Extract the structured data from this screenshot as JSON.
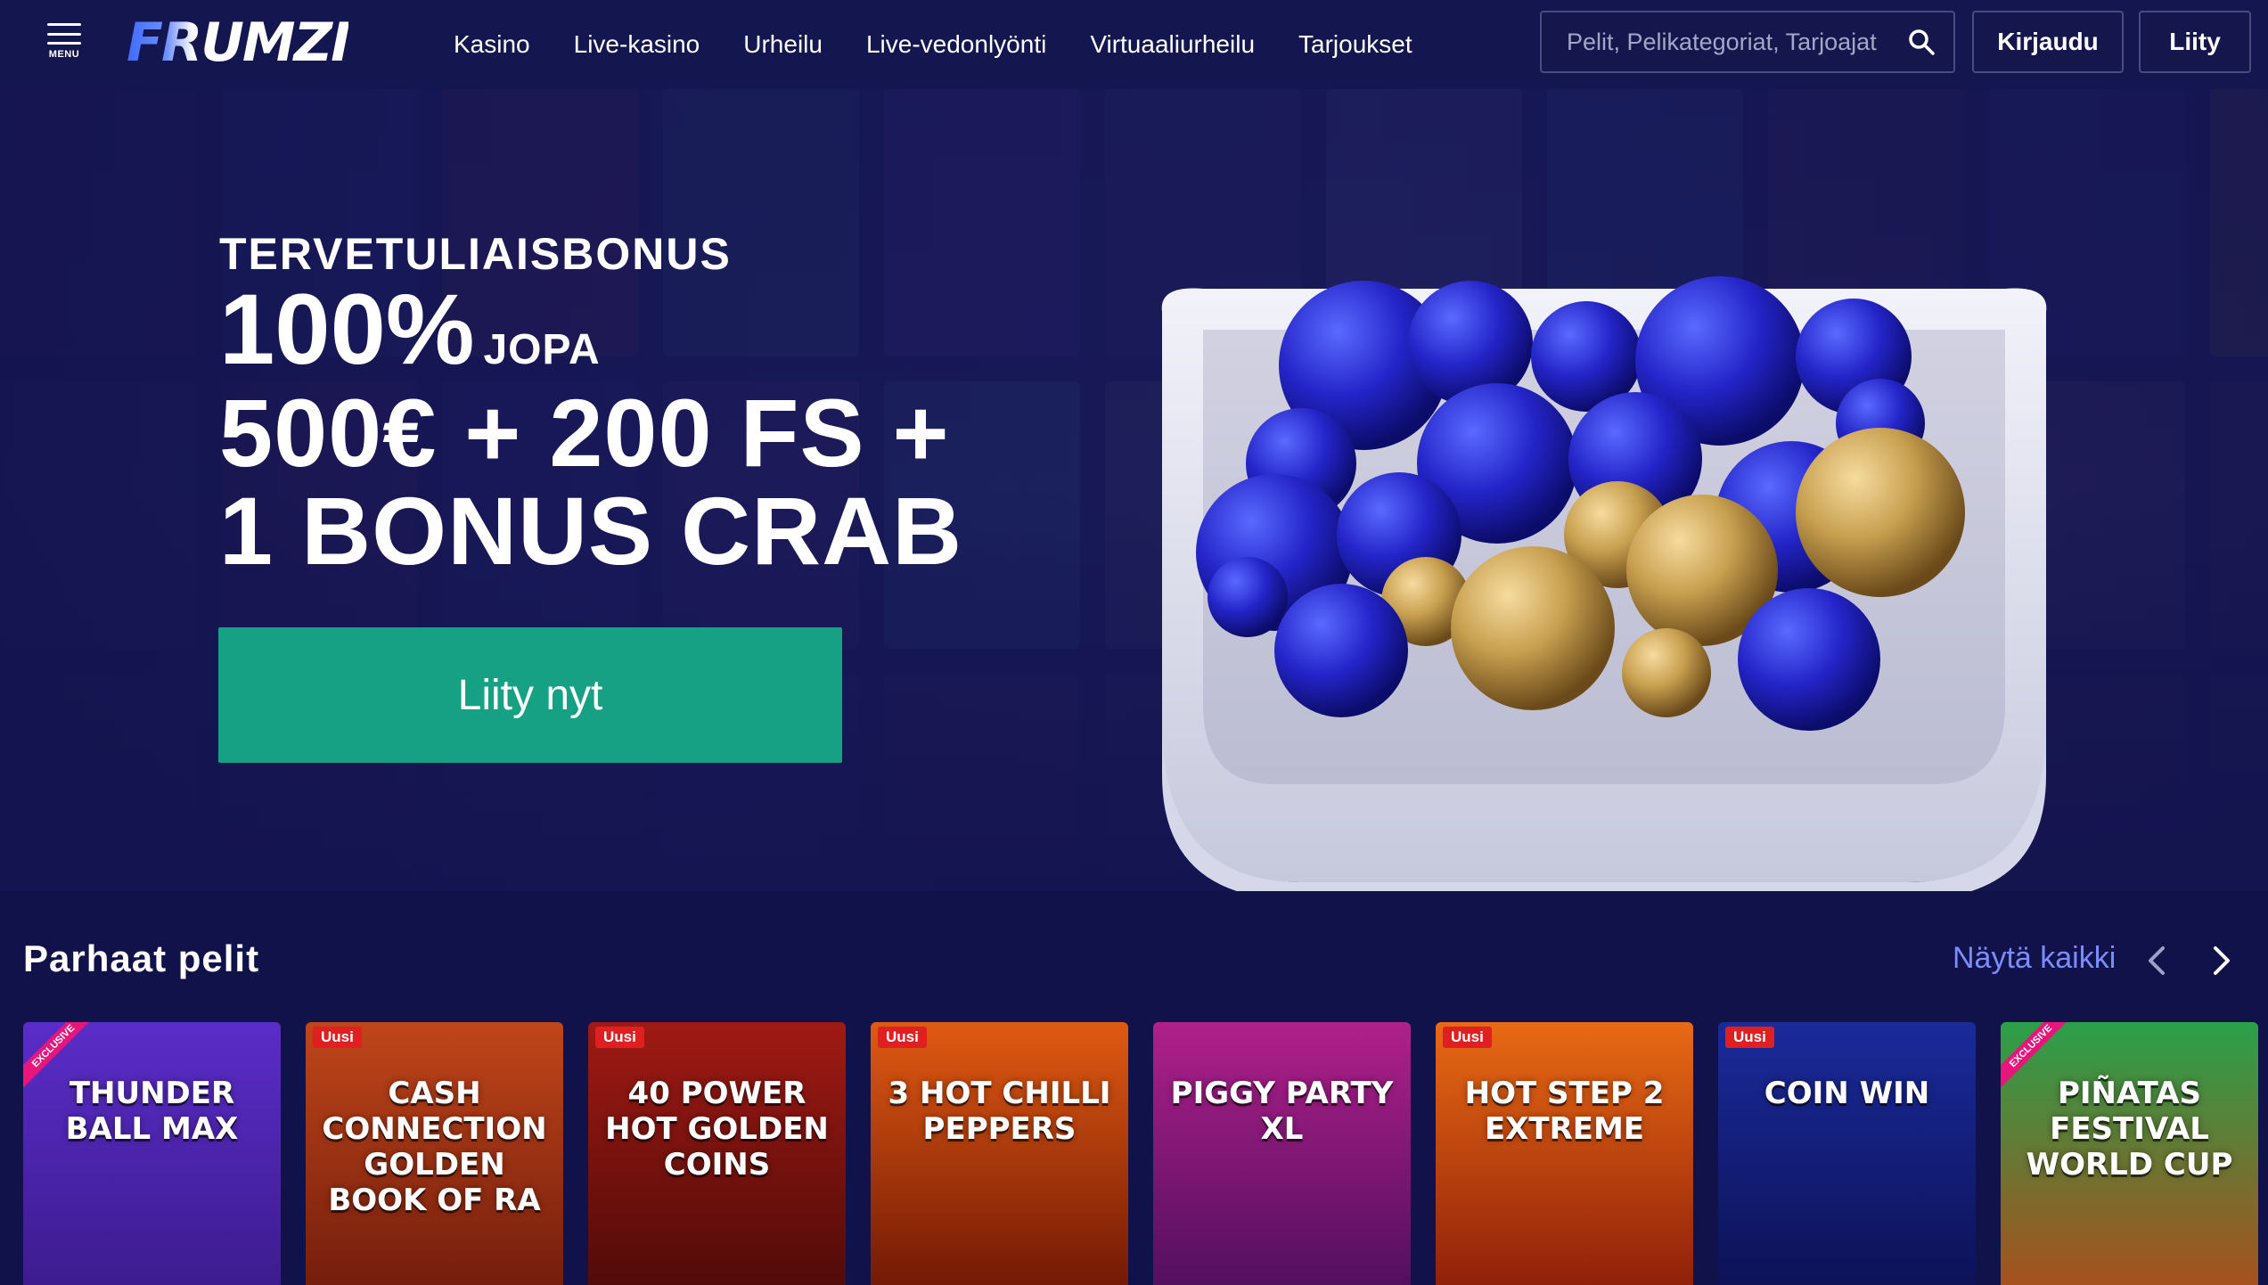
{
  "header": {
    "menu_label": "MENU",
    "logo_text": "FRUMZI",
    "nav": [
      "Kasino",
      "Live-kasino",
      "Urheilu",
      "Live-vedonlyönti",
      "Virtuaaliurheilu",
      "Tarjoukset"
    ],
    "search_placeholder": "Pelit, Pelikategoriat, Tarjoajat",
    "login_label": "Kirjaudu",
    "join_label": "Liity"
  },
  "hero": {
    "eyebrow": "TERVETULIAISBONUS",
    "line1_big": "100%",
    "line1_small": "JOPA",
    "line2": "500€ + 200 FS +",
    "line3": "1 BONUS CRAB",
    "cta_label": "Liity nyt"
  },
  "games_section": {
    "title": "Parhaat pelit",
    "see_all": "Näytä kaikki",
    "games": [
      {
        "title": "Thunder Ball Max",
        "badge": "EXCLUSIVE",
        "bg": [
          "#5a2dc8",
          "#3a1a8a"
        ]
      },
      {
        "title": "Cash Connection Golden Book of Ra",
        "badge": "Uusi",
        "bg": [
          "#c0461a",
          "#6e1a0c"
        ]
      },
      {
        "title": "40 Power Hot Golden Coins",
        "badge": "Uusi",
        "bg": [
          "#a01a14",
          "#4a0a08"
        ]
      },
      {
        "title": "3 Hot Chilli Peppers",
        "badge": "Uusi",
        "bg": [
          "#e05a12",
          "#6a1405"
        ]
      },
      {
        "title": "Piggy Party XL",
        "badge": "",
        "bg": [
          "#b0208a",
          "#4a0e5c"
        ]
      },
      {
        "title": "Hot Step 2 Extreme",
        "badge": "Uusi",
        "bg": [
          "#e86a14",
          "#8a1a0a"
        ]
      },
      {
        "title": "Coin Win",
        "badge": "Uusi",
        "bg": [
          "#1a2a9a",
          "#0c1050"
        ]
      },
      {
        "title": "Piñatas Festival World Cup",
        "badge": "EXCLUSIVE",
        "bg": [
          "#2aa04a",
          "#b04a1a"
        ]
      }
    ]
  },
  "colors": {
    "accent": "#16a084",
    "link": "#7b8cff",
    "background": "#12124a"
  }
}
